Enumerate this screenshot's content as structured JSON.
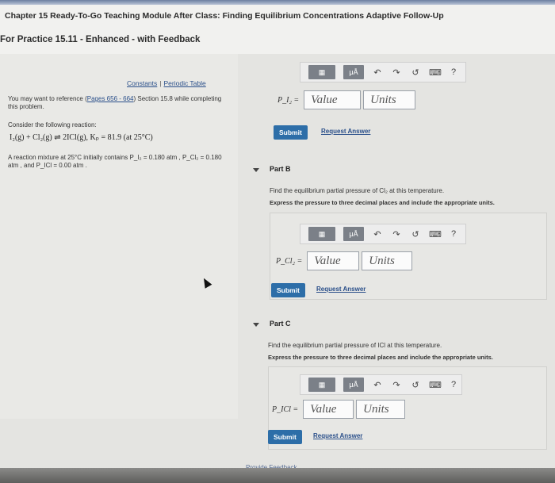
{
  "header": {
    "title": "Chapter 15 Ready-To-Go Teaching Module After Class: Finding Equilibrium Concentrations Adaptive Follow-Up",
    "subtitle": "For Practice 15.11 - Enhanced - with Feedback"
  },
  "left": {
    "constants": "Constants",
    "periodic": "Periodic Table",
    "ref_pre": "You may want to reference (",
    "ref_link": "Pages 656 - 664",
    "ref_post": ") Section 15.8 while completing this problem.",
    "consider": "Consider the following reaction:",
    "reaction": "I₂(g) + Cl₂(g) ⇌ 2ICl(g),   Kₚ = 81.9 (at 25°C)",
    "mixture": "A reaction mixture at 25°C initially contains P_I₂ = 0.180 atm , P_Cl₂ = 0.180 atm , and P_ICl = 0.00 atm ."
  },
  "toolbar": {
    "templates_btn": "▦",
    "units_btn": "μÅ",
    "undo_icon": "↶",
    "redo_icon": "↷",
    "reset_icon": "↺",
    "keyboard_icon": "⌨",
    "help_icon": "?"
  },
  "partA": {
    "var": "P_I₂ =",
    "value_placeholder": "Value",
    "units_placeholder": "Units",
    "submit": "Submit",
    "request": "Request Answer"
  },
  "partB": {
    "label": "Part B",
    "find": "Find the equilibrium partial pressure of Cl₂ at this temperature.",
    "express": "Express the pressure to three decimal places and include the appropriate units.",
    "var": "P_Cl₂ =",
    "value_placeholder": "Value",
    "units_placeholder": "Units",
    "submit": "Submit",
    "request": "Request Answer"
  },
  "partC": {
    "label": "Part C",
    "find": "Find the equilibrium partial pressure of ICl at this temperature.",
    "express": "Express the pressure to three decimal places and include the appropriate units.",
    "var": "P_ICl =",
    "value_placeholder": "Value",
    "units_placeholder": "Units",
    "submit": "Submit",
    "request": "Request Answer"
  },
  "footer": {
    "feedback": "Provide Feedback"
  }
}
